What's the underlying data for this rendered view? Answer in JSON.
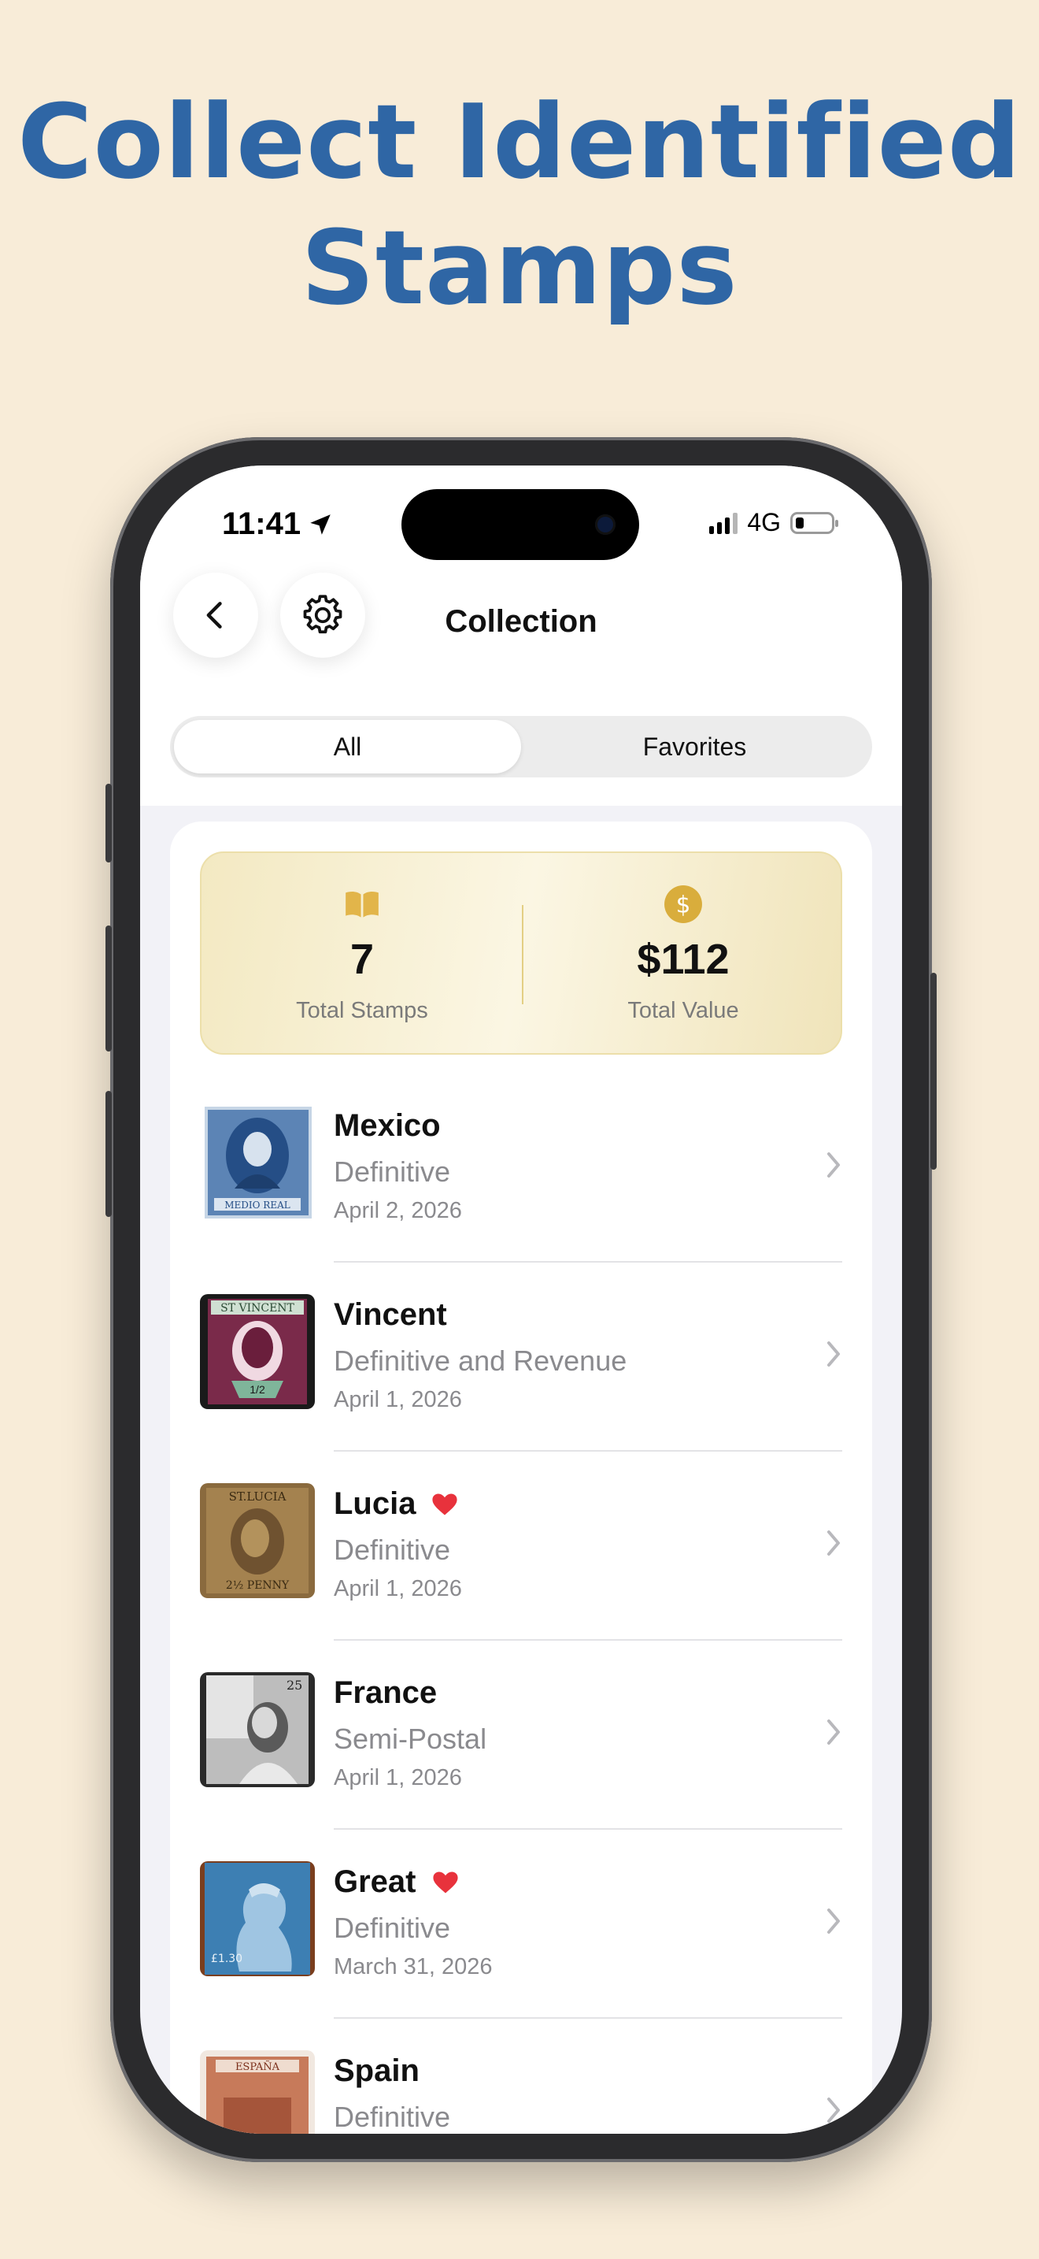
{
  "headline": {
    "line1": "Collect Identified",
    "line2": "Stamps"
  },
  "status_bar": {
    "time": "11:41",
    "network": "4G"
  },
  "nav": {
    "title": "Collection"
  },
  "segments": {
    "all": "All",
    "favorites": "Favorites",
    "selected": "All"
  },
  "stats": {
    "total_stamps": {
      "value": "7",
      "label": "Total Stamps"
    },
    "total_value": {
      "value": "$112",
      "label": "Total Value",
      "icon_glyph": "$"
    }
  },
  "colors": {
    "headline": "#2f66a5",
    "background": "#f8ecd8",
    "favorite": "#e8323c",
    "gold": "#e0b54a"
  },
  "stamps": [
    {
      "name": "Mexico",
      "type": "Definitive",
      "date": "April 2, 2026",
      "favorite": false
    },
    {
      "name": "Vincent",
      "type": "Definitive and Revenue",
      "date": "April 1, 2026",
      "favorite": false
    },
    {
      "name": "Lucia",
      "type": "Definitive",
      "date": "April 1, 2026",
      "favorite": true
    },
    {
      "name": "France",
      "type": "Semi-Postal",
      "date": "April 1, 2026",
      "favorite": false
    },
    {
      "name": "Great",
      "type": "Definitive",
      "date": "March 31, 2026",
      "favorite": true
    },
    {
      "name": "Spain",
      "type": "Definitive",
      "date": "",
      "favorite": false
    }
  ]
}
